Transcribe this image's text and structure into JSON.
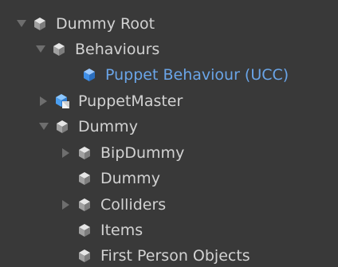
{
  "hierarchy": {
    "rows": [
      {
        "label": "Dummy Root",
        "expander": "expanded-arrow-icon",
        "icon": "gameobject-cube-icon",
        "state": "normal"
      },
      {
        "label": "Behaviours",
        "expander": "expanded-arrow-icon",
        "icon": "gameobject-cube-icon",
        "state": "normal"
      },
      {
        "label": "Puppet Behaviour (UCC)",
        "expander": "none",
        "icon": "gameobject-cube-icon",
        "state": "selected"
      },
      {
        "label": "PuppetMaster",
        "expander": "collapsed-arrow-icon",
        "icon": "prefab-cube-icon",
        "state": "normal"
      },
      {
        "label": "Dummy",
        "expander": "expanded-arrow-icon",
        "icon": "gameobject-cube-icon",
        "state": "normal"
      },
      {
        "label": "BipDummy",
        "expander": "collapsed-arrow-icon",
        "icon": "gameobject-cube-icon",
        "state": "normal"
      },
      {
        "label": "Dummy",
        "expander": "none",
        "icon": "gameobject-cube-icon",
        "state": "normal"
      },
      {
        "label": "Colliders",
        "expander": "collapsed-arrow-icon",
        "icon": "gameobject-cube-icon",
        "state": "normal"
      },
      {
        "label": "Items",
        "expander": "none",
        "icon": "gameobject-cube-icon",
        "state": "normal"
      },
      {
        "label": "First Person Objects",
        "expander": "none",
        "icon": "gameobject-cube-icon",
        "state": "normal"
      }
    ]
  },
  "colors": {
    "background": "#393939",
    "text": "#d2d2d2",
    "selected_text": "#6aa5e8",
    "arrow": "#6e6e6e"
  }
}
